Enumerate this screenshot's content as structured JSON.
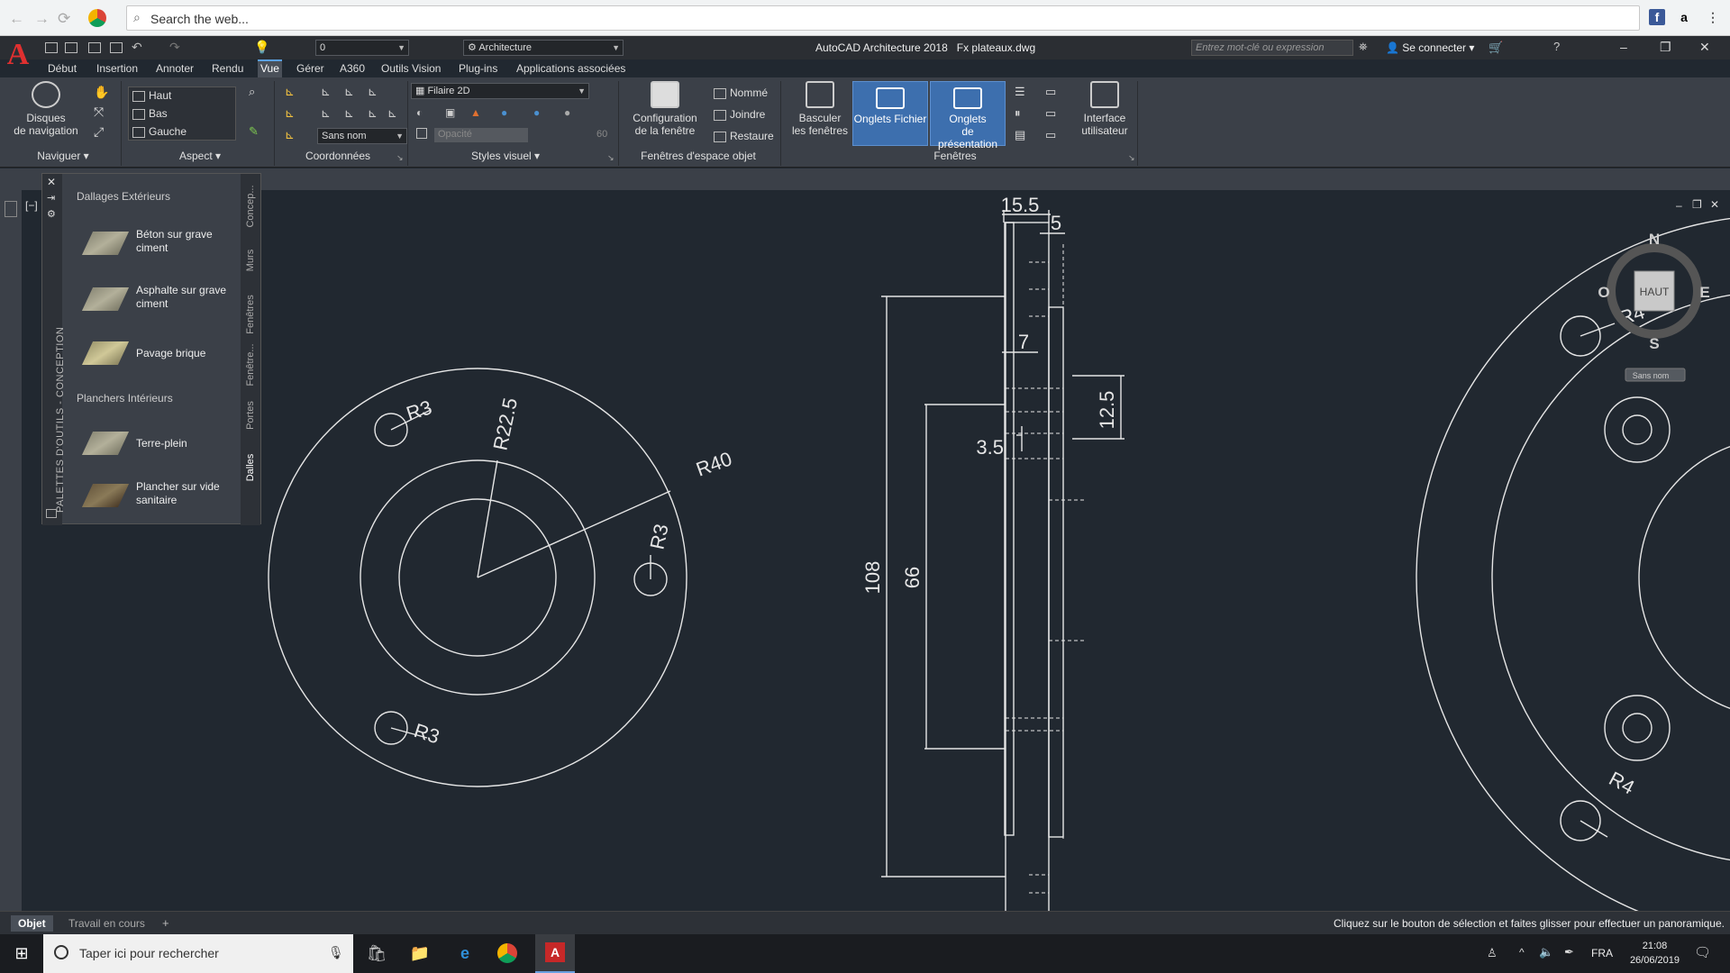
{
  "browser": {
    "search_placeholder": "Search the web..."
  },
  "app": {
    "title": "AutoCAD Architecture 2018",
    "file": "Fx plateaux.dwg",
    "workspace": "Architecture",
    "layer": "0",
    "search_placeholder": "Entrez mot-clé ou expression",
    "signin": "Se connecter"
  },
  "ribbon_tabs": [
    "Début",
    "Insertion",
    "Annoter",
    "Rendu",
    "Vue",
    "Gérer",
    "A360",
    "Outils Vision",
    "Plug-ins",
    "Applications associées"
  ],
  "ribbon_active_tab": "Vue",
  "ribbon": {
    "navigate": {
      "title": "Naviguer",
      "disks_label": "Disques\nde navigation"
    },
    "aspect": {
      "title": "Aspect",
      "views": [
        "Haut",
        "Bas",
        "Gauche"
      ]
    },
    "coords": {
      "title": "Coordonnées",
      "ucs": "Sans nom"
    },
    "visual_styles": {
      "title": "Styles visuel",
      "style": "Filaire 2D",
      "opacity_label": "Opacité",
      "opacity_value": "60"
    },
    "model_viewports": {
      "title": "Fenêtres d'espace objet",
      "config_label": "Configuration\nde la fenêtre",
      "named": "Nommé",
      "join": "Joindre",
      "restore": "Restaure"
    },
    "windows": {
      "title": "Fenêtres",
      "switch_label": "Basculer\nles fenêtres",
      "file_tabs_label": "Onglets Fichier",
      "layout_tabs_label": "Onglets\nde présentation",
      "ui_label": "Interface\nutilisateur"
    }
  },
  "palette": {
    "vertical_title": "PALETTES D'OUTILS - CONCEPTION",
    "sections": [
      {
        "heading": "Dallages Extérieurs",
        "items": [
          "Béton sur grave ciment",
          "Asphalte sur grave ciment",
          "Pavage brique"
        ]
      },
      {
        "heading": "Planchers Intérieurs",
        "items": [
          "Terre-plein",
          "Plancher sur vide sanitaire"
        ]
      }
    ],
    "tabs": [
      "Concep...",
      "Murs",
      "Fenêtres",
      "Fenêtre...",
      "Portes",
      "Dalles"
    ],
    "active_tab": "Dalles"
  },
  "drawing": {
    "viewport_label": "[−]",
    "left_view_dims": [
      "R3",
      "R22.5",
      "R40",
      "R3",
      "R3"
    ],
    "section_dims": [
      "15.5",
      "5",
      "7",
      "12.5",
      "3.5",
      "108",
      "66"
    ],
    "right_view_dims": [
      "R4",
      "R4"
    ],
    "viewcube": {
      "north": "N",
      "south": "S",
      "east": "E",
      "west": "O",
      "face": "HAUT",
      "ucs_menu": "Sans nom"
    }
  },
  "layout_tabs": [
    "Objet",
    "Travail en cours"
  ],
  "layout_active": "Objet",
  "status_message": "Cliquez sur le bouton de sélection et faites glisser pour effectuer un panoramique.",
  "taskbar": {
    "search_placeholder": "Taper ici pour rechercher",
    "language": "FRA",
    "time": "21:08",
    "date": "26/06/2019"
  }
}
